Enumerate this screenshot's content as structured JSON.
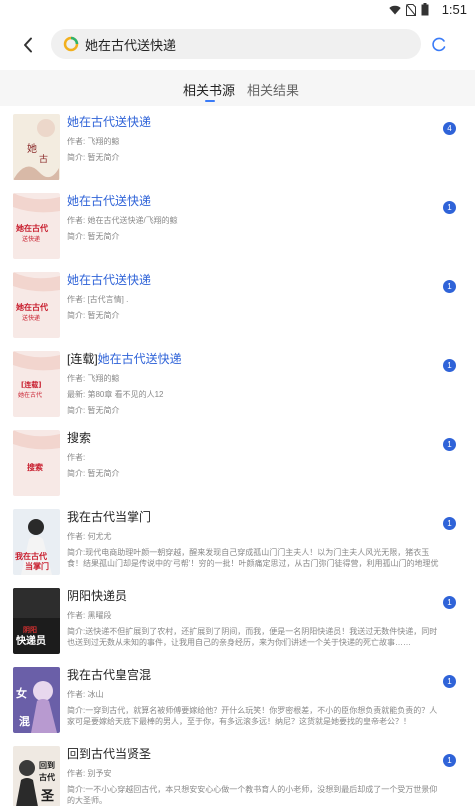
{
  "status": {
    "time": "1:51"
  },
  "search": {
    "query": "她在古代送快递"
  },
  "tabs": [
    {
      "label": "相关书源",
      "active": true
    },
    {
      "label": "相关结果",
      "active": false
    }
  ],
  "results": [
    {
      "title": "她在古代送快递",
      "title_prefix": "",
      "author": "作者: 飞翔的鲸",
      "latest": "",
      "intro": "简介: 暂无简介",
      "badge": "4",
      "cover_text": "她在古代送快递",
      "cover_bg": "#f3ece0"
    },
    {
      "title": "她在古代送快递",
      "title_prefix": "",
      "author": "作者: 她在古代送快递/飞翔的鲸",
      "latest": "",
      "intro": "简介: 暂无简介",
      "badge": "1",
      "cover_text": "她在古代送快递",
      "cover_bg": "#f7e9e6"
    },
    {
      "title": "她在古代送快递",
      "title_prefix": "",
      "author": "作者: [古代言情] .",
      "latest": "",
      "intro": "简介: 暂无简介",
      "badge": "1",
      "cover_text": "她在古代送快递",
      "cover_bg": "#f7e9e6"
    },
    {
      "title": "她在古代送快递",
      "title_prefix": "[连载]",
      "author": "作者: 飞翔的鲸",
      "latest": "最新: 第80章 看不见的人12",
      "intro": "简介: 暂无简介",
      "badge": "1",
      "cover_text": "[连载]",
      "cover_bg": "#f7e9e6"
    },
    {
      "title": "搜索",
      "title_prefix": "",
      "author": "作者:",
      "latest": "",
      "intro": "简介: 暂无简介",
      "badge": "1",
      "cover_text": "搜索",
      "cover_bg": "#f7e9e6"
    },
    {
      "title": "我在古代当掌门",
      "title_prefix": "",
      "author": "作者: 何尤尤",
      "latest": "",
      "intro": "简介:现代电商助理叶颜一朝穿越，醒来发现自己穿成孤山门门主夫人！以为门主夫人风光无限，猪衣玉食！结果孤山门却是传说中的‘弓帮’！穷的一批！叶颜痛定思过，从古门弥门徒得营，利用孤山门的地理优势发展快递业务，也映我们门派合作，建立古代网里巴巴·宅e店淘，带领门派走上下过好日子！",
      "badge": "1",
      "cover_text": "我在古代当掌门",
      "cover_bg": "#e9eef3"
    },
    {
      "title": "阴阳快递员",
      "title_prefix": "",
      "author": "作者: 黑曜段",
      "latest": "",
      "intro": "简介:送快递不但扩展到了农村，还扩展到了阴间，而我，便是一名阴阳快递员！我送过无数件快递，同时也送到过无数从未知的事件，让我用自己的亲身经历，来为你们讲述一个关于快递的死亡故事……",
      "badge": "1",
      "cover_text": "快递员",
      "cover_bg": "#1c1c1c"
    },
    {
      "title": "我在古代皇宫混",
      "title_prefix": "",
      "author": "作者: 冰山",
      "latest": "",
      "intro": "简介:一穿到古代，就算名被师傅要嫁给他？开什么玩笑！你罗密根差，不小的臣你想负责就能负责的？人家可是要嫁给天底下最棒的男人，至于你，有多远滚多远！纳尼？这货就是她要找的皇帝老公？！",
      "badge": "1",
      "cover_text": "我在古代皇宫混",
      "cover_bg": "#6a5fa8"
    },
    {
      "title": "回到古代当贤圣",
      "title_prefix": "",
      "author": "作者: 别予安",
      "latest": "",
      "intro": "简介:一不小心穿越回古代，本只想安安心心做一个教书育人的小老师，没想到最后却成了一个受万世景仰的大圣师。",
      "badge": "1",
      "cover_text": "回到古代当贤圣",
      "cover_bg": "#efe9e2"
    }
  ]
}
